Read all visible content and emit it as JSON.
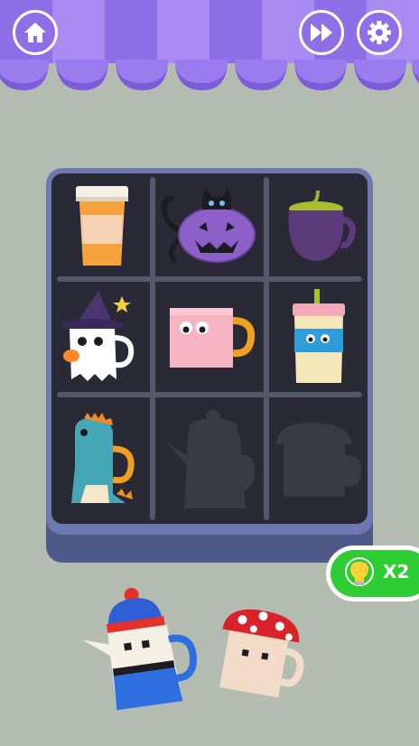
{
  "header": {
    "home_button": {
      "icon": "home-icon"
    },
    "skip_button": {
      "icon": "fast-forward-icon"
    },
    "settings_button": {
      "icon": "gear-icon"
    }
  },
  "colors": {
    "background": "#b4bcb1",
    "awning_purple": "#8f6fe8",
    "awning_light": "#a98af0",
    "board_frame": "#6d78b3",
    "board_inner": "#2a2a37",
    "hint_green": "#2fcd34"
  },
  "board": {
    "rows": 3,
    "cols": 3,
    "slots": [
      {
        "item": "coffee-cup",
        "filled": true
      },
      {
        "item": "pumpkin-cat-teapot",
        "filled": true
      },
      {
        "item": "purple-cauldron-pot",
        "filled": true
      },
      {
        "item": "ghost-witch-mug",
        "filled": true
      },
      {
        "item": "pink-face-mug",
        "filled": true
      },
      {
        "item": "blue-face-cup",
        "filled": true
      },
      {
        "item": "dinosaur-mug",
        "filled": true
      },
      {
        "item": "teapot-silhouette",
        "filled": false
      },
      {
        "item": "mushroom-mug-silhouette",
        "filled": false
      }
    ]
  },
  "hint": {
    "icon": "lightbulb-icon",
    "label": "X2"
  },
  "tray": [
    {
      "item": "beanie-teapot"
    },
    {
      "item": "mushroom-mug"
    }
  ]
}
